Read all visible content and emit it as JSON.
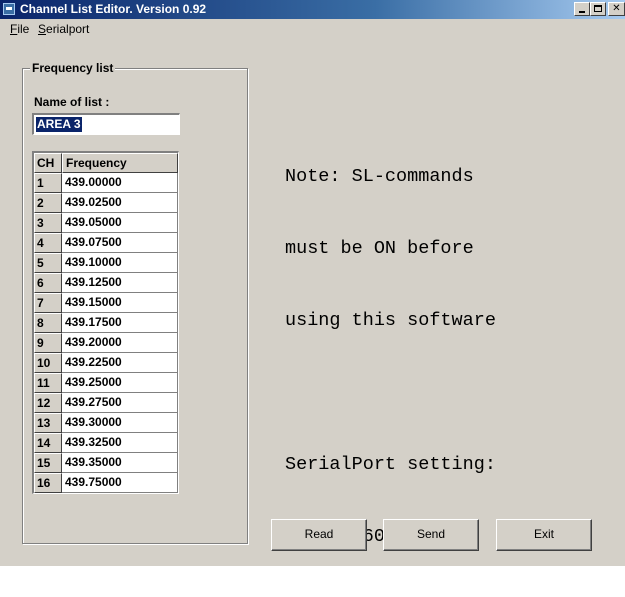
{
  "window": {
    "title": "Channel List Editor. Version 0.92",
    "icon": "app-icon",
    "controls": [
      "minimize",
      "maximize",
      "close"
    ]
  },
  "menu": {
    "file": {
      "mnemonic": "F",
      "rest": "ile"
    },
    "serialport": {
      "mnemonic": "S",
      "rest": "erialport"
    }
  },
  "frequency_group": {
    "legend": "Frequency list",
    "name_label": "Name of list :",
    "name_value": "AREA 3"
  },
  "table": {
    "headers": {
      "ch": "CH",
      "frequency": "Frequency"
    },
    "rows": [
      {
        "ch": "1",
        "freq": "439.00000"
      },
      {
        "ch": "2",
        "freq": "439.02500"
      },
      {
        "ch": "3",
        "freq": "439.05000"
      },
      {
        "ch": "4",
        "freq": "439.07500"
      },
      {
        "ch": "5",
        "freq": "439.10000"
      },
      {
        "ch": "6",
        "freq": "439.12500"
      },
      {
        "ch": "7",
        "freq": "439.15000"
      },
      {
        "ch": "8",
        "freq": "439.17500"
      },
      {
        "ch": "9",
        "freq": "439.20000"
      },
      {
        "ch": "10",
        "freq": "439.22500"
      },
      {
        "ch": "11",
        "freq": "439.25000"
      },
      {
        "ch": "12",
        "freq": "439.27500"
      },
      {
        "ch": "13",
        "freq": "439.30000"
      },
      {
        "ch": "14",
        "freq": "439.32500"
      },
      {
        "ch": "15",
        "freq": "439.35000"
      },
      {
        "ch": "16",
        "freq": "439.75000"
      }
    ]
  },
  "note": {
    "line1": "Note: SL-commands",
    "line2": "must be ON before",
    "line3": "using this software",
    "line4": "SerialPort setting:",
    "line5": "Com1: 9600,8,None"
  },
  "buttons": {
    "read": "Read",
    "send": "Send",
    "exit": "Exit"
  },
  "colors": {
    "face": "#d4d0c8",
    "title_start": "#0a246a",
    "title_end": "#a6caf0",
    "selection": "#0a246a"
  }
}
